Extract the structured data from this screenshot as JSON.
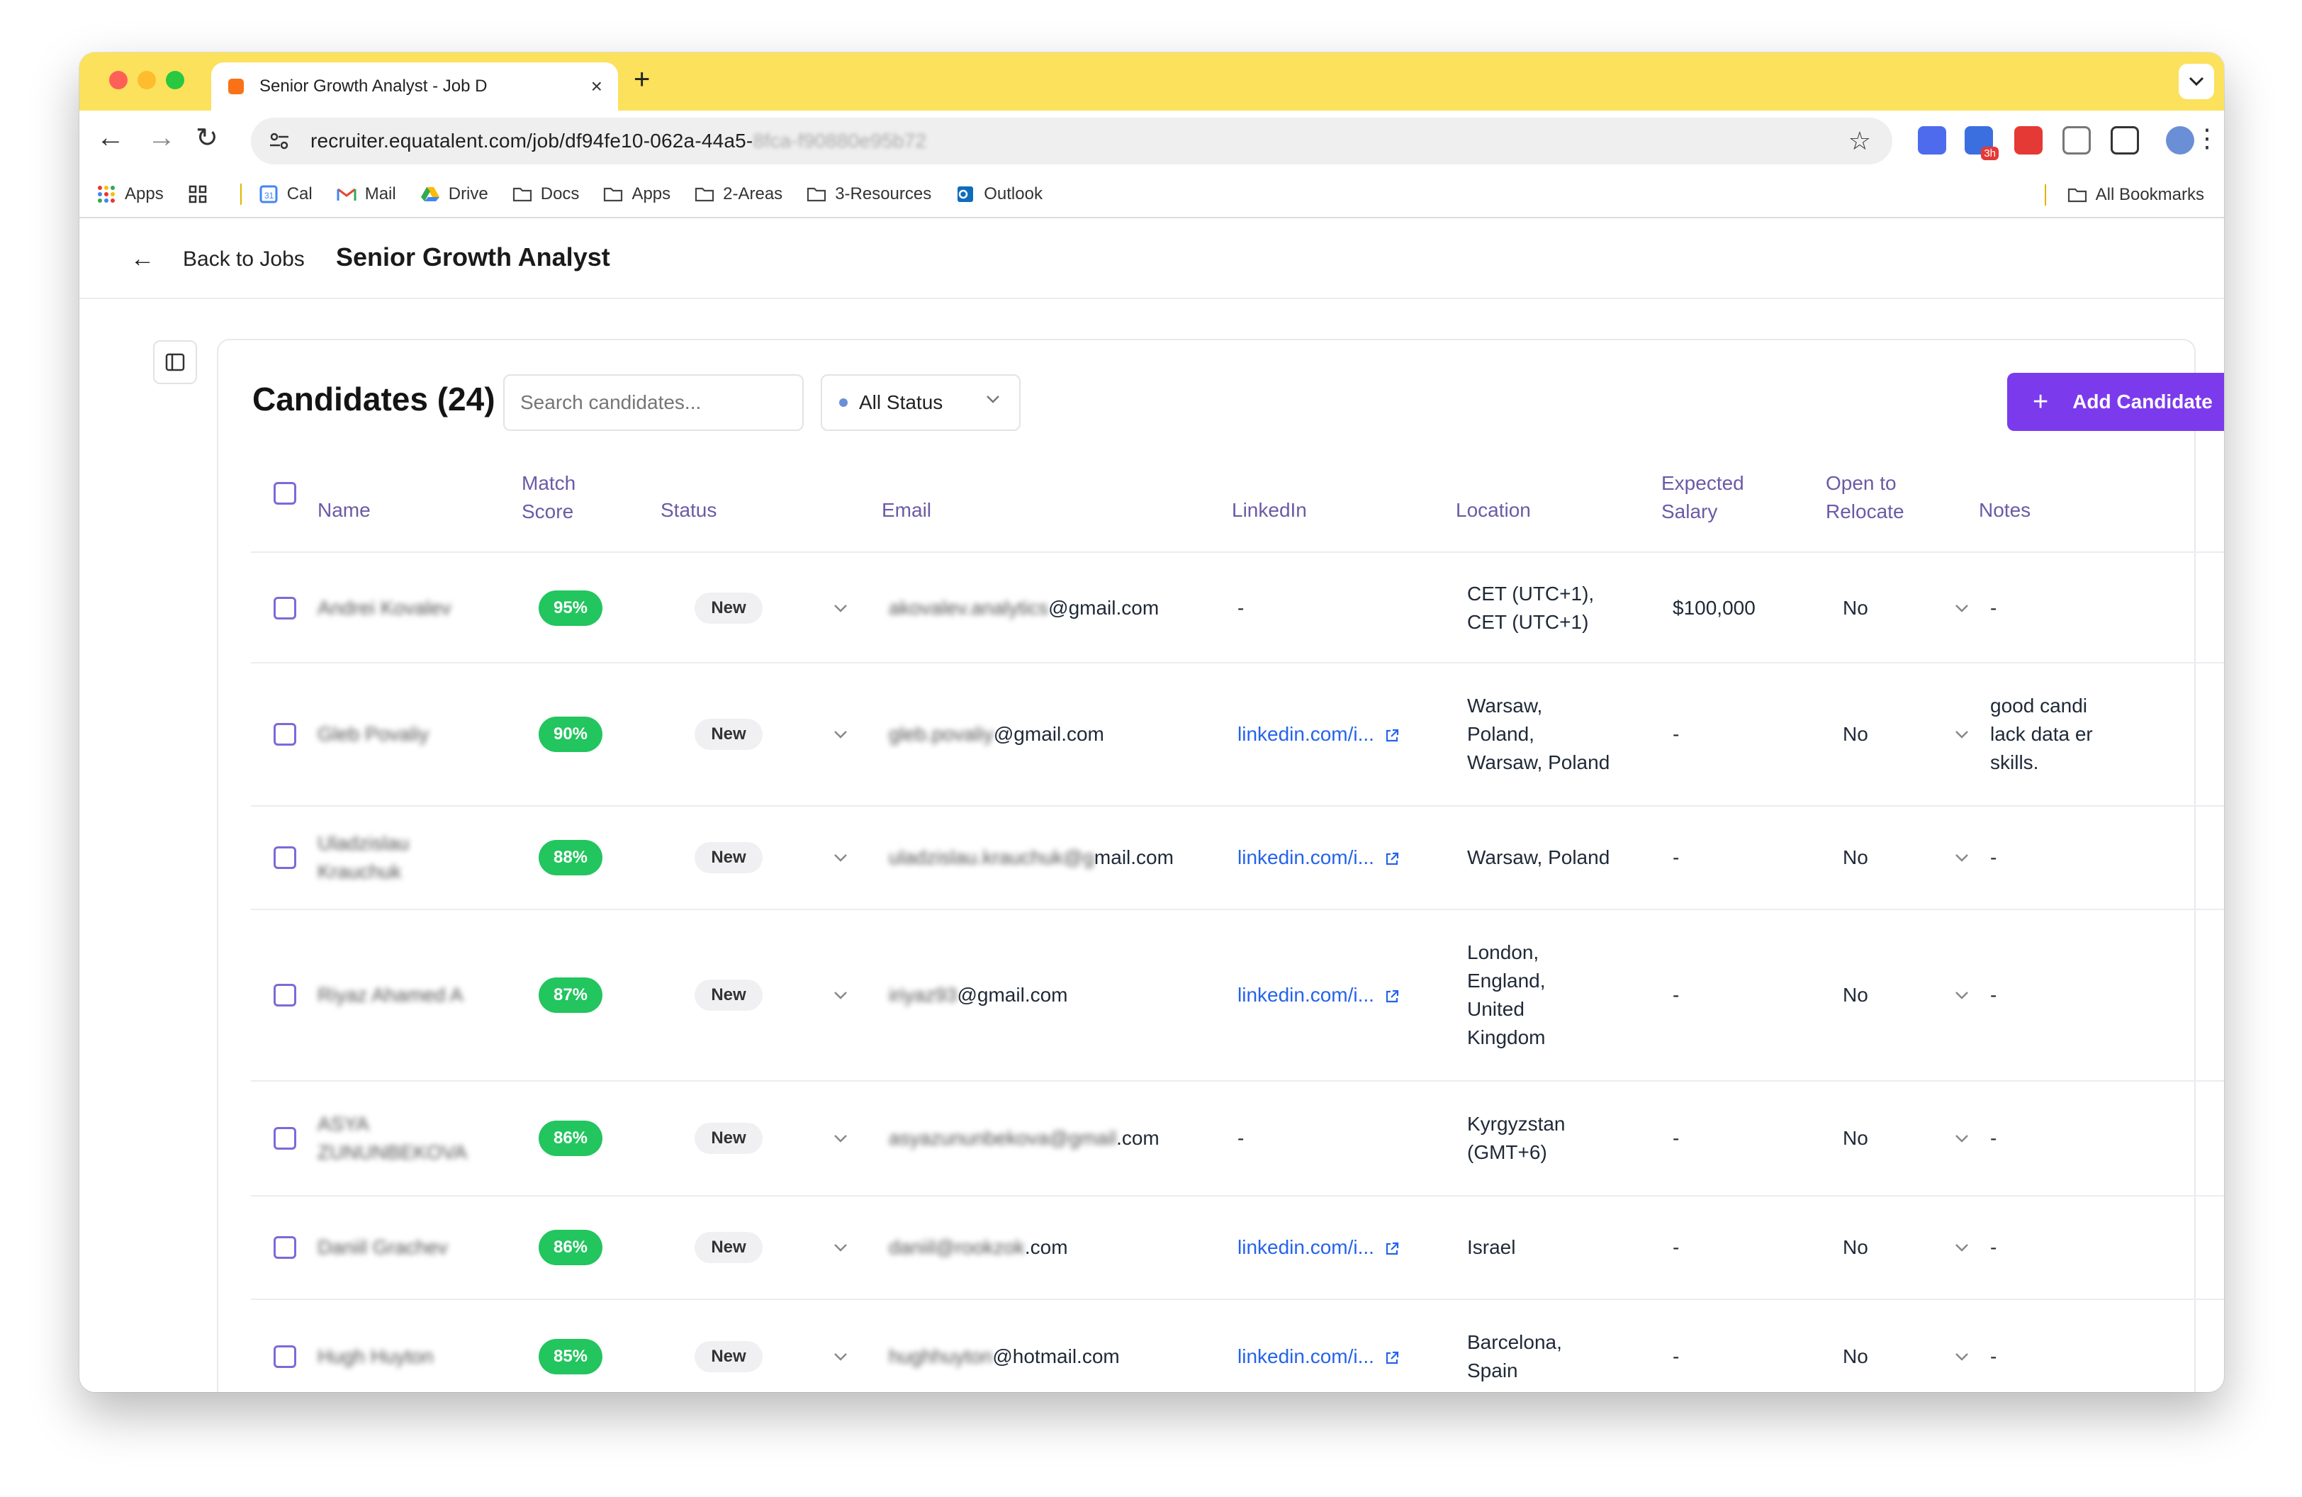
{
  "browser": {
    "tab_title": "Senior Growth Analyst - Job D",
    "new_tab": "+",
    "close": "×",
    "url_visible": "recruiter.equatalent.com/job/df94fe10-062a-44a5-",
    "url_blurred": "8fca-f90880e95b72",
    "extension_badge": "3h",
    "bookmarks": [
      {
        "label": "Apps",
        "icon": "apps-grid-icon"
      },
      {
        "label": "",
        "icon": "grid-icon"
      },
      {
        "label": "Cal",
        "icon": "calendar-icon"
      },
      {
        "label": "Mail",
        "icon": "gmail-icon"
      },
      {
        "label": "Drive",
        "icon": "drive-icon"
      },
      {
        "label": "Docs",
        "icon": "folder-icon"
      },
      {
        "label": "Apps",
        "icon": "folder-icon"
      },
      {
        "label": "2-Areas",
        "icon": "folder-icon"
      },
      {
        "label": "3-Resources",
        "icon": "folder-icon"
      },
      {
        "label": "Outlook",
        "icon": "outlook-icon"
      }
    ],
    "all_bookmarks": "All Bookmarks"
  },
  "header": {
    "back_label": "Back to Jobs",
    "page_title": "Senior Growth Analyst"
  },
  "candidates": {
    "title": "Candidates (24)",
    "search_placeholder": "Search candidates...",
    "status_filter": "All Status",
    "add_button": "Add Candidate",
    "columns": {
      "name": "Name",
      "match_1": "Match",
      "match_2": "Score",
      "status": "Status",
      "email": "Email",
      "linkedin": "LinkedIn",
      "location": "Location",
      "salary_1": "Expected",
      "salary_2": "Salary",
      "relocate_1": "Open to",
      "relocate_2": "Relocate",
      "notes": "Notes"
    },
    "rows": [
      {
        "name_1": "Andrei Kovalev",
        "name_2": "",
        "score": "95%",
        "status": "New",
        "email_blur": "akovalev.analytics",
        "email_domain": "@gmail.com",
        "linkedin": "-",
        "location": [
          "CET (UTC+1),",
          "CET (UTC+1)"
        ],
        "salary": "$100,000",
        "relocate": "No",
        "notes": [
          "-"
        ]
      },
      {
        "name_1": "Gleb Povaliy",
        "name_2": "",
        "score": "90%",
        "status": "New",
        "email_blur": "gleb.povaliy",
        "email_domain": "@gmail.com",
        "linkedin": "linkedin.com/i...",
        "location": [
          "Warsaw,",
          "Poland,",
          "Warsaw, Poland"
        ],
        "salary": "-",
        "relocate": "No",
        "notes": [
          "good candi",
          "lack data er",
          "skills."
        ]
      },
      {
        "name_1": "Uladzislau",
        "name_2": "Krauchuk",
        "score": "88%",
        "status": "New",
        "email_blur": "uladzislau.krauchuk@g",
        "email_domain": "mail.com",
        "linkedin": "linkedin.com/i...",
        "location": [
          "Warsaw, Poland"
        ],
        "salary": "-",
        "relocate": "No",
        "notes": [
          "-"
        ]
      },
      {
        "name_1": "Riyaz Ahamed A",
        "name_2": "",
        "score": "87%",
        "status": "New",
        "email_blur": "iriyaz93",
        "email_domain": "@gmail.com",
        "linkedin": "linkedin.com/i...",
        "location": [
          "London,",
          "England,",
          "United",
          "Kingdom"
        ],
        "salary": "-",
        "relocate": "No",
        "notes": [
          "-"
        ]
      },
      {
        "name_1": "ASYA",
        "name_2": "ZUNUNBEKOVA",
        "score": "86%",
        "status": "New",
        "email_blur": "asyazununbekova@gmail",
        "email_domain": ".com",
        "linkedin": "-",
        "location": [
          "Kyrgyzstan",
          "(GMT+6)"
        ],
        "salary": "-",
        "relocate": "No",
        "notes": [
          "-"
        ]
      },
      {
        "name_1": "Daniil Grachev",
        "name_2": "",
        "score": "86%",
        "status": "New",
        "email_blur": "daniil@rookzok",
        "email_domain": ".com",
        "linkedin": "linkedin.com/i...",
        "location": [
          "Israel"
        ],
        "salary": "-",
        "relocate": "No",
        "notes": [
          "-"
        ]
      },
      {
        "name_1": "Hugh Huyton",
        "name_2": "",
        "score": "85%",
        "status": "New",
        "email_blur": "hughhuyton",
        "email_domain": "@hotmail.com",
        "linkedin": "linkedin.com/i...",
        "location": [
          "Barcelona,",
          "Spain"
        ],
        "salary": "-",
        "relocate": "No",
        "notes": [
          "-"
        ]
      }
    ]
  },
  "colors": {
    "titlebar": "#fbe15c",
    "accent": "#7c3aed",
    "score_green": "#22c55e",
    "link": "#2563eb"
  }
}
